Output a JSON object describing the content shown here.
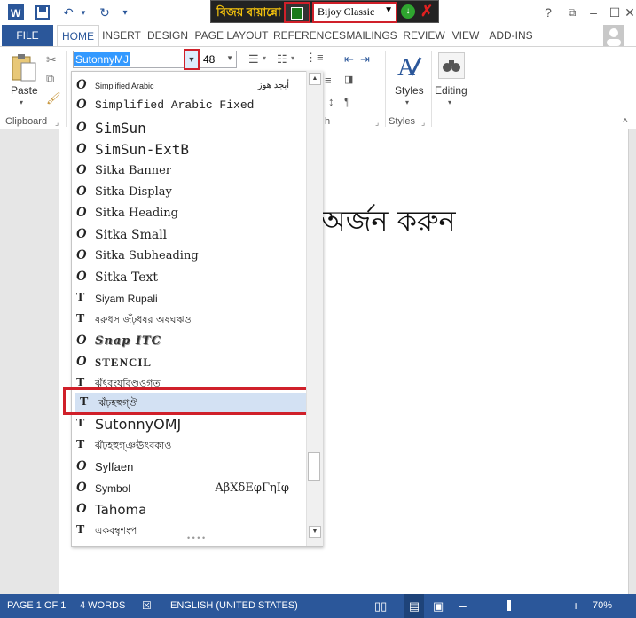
{
  "titlebar": {
    "bijoy_logo_left": "বিজয়",
    "bijoy_logo_right": "বায়ান্নো",
    "keyboard_select": "Bijoy Classic"
  },
  "tabs": [
    "FILE",
    "HOME",
    "INSERT",
    "DESIGN",
    "PAGE LAYOUT",
    "REFERENCES",
    "MAILINGS",
    "REVIEW",
    "VIEW",
    "ADD-INS"
  ],
  "ribbon": {
    "paste_label": "Paste",
    "clipboard_label": "Clipboard",
    "font_name": "SutonnyMJ",
    "font_size": "48",
    "styles_group_label": "Styles",
    "styles_button": "Styles",
    "editing_button": "Editing",
    "paragraph_label_fragment": "h"
  },
  "document": {
    "visible_text": "অর্জন করুন"
  },
  "font_list": [
    {
      "name": "Simplified Arabic",
      "sample": "أبجد هوز",
      "icon": "opentype-icon"
    },
    {
      "name": "Simplified Arabic Fixed",
      "sample": "",
      "icon": "opentype-icon"
    },
    {
      "name": "SimSun",
      "sample": "",
      "icon": "opentype-icon"
    },
    {
      "name": "SimSun-ExtB",
      "sample": "",
      "icon": "opentype-icon"
    },
    {
      "name": "Sitka Banner",
      "sample": "",
      "icon": "opentype-icon"
    },
    {
      "name": "Sitka Display",
      "sample": "",
      "icon": "opentype-icon"
    },
    {
      "name": "Sitka Heading",
      "sample": "",
      "icon": "opentype-icon"
    },
    {
      "name": "Sitka Small",
      "sample": "",
      "icon": "opentype-icon"
    },
    {
      "name": "Sitka Subheading",
      "sample": "",
      "icon": "opentype-icon"
    },
    {
      "name": "Sitka Text",
      "sample": "",
      "icon": "opentype-icon"
    },
    {
      "name": "Siyam Rupali",
      "sample": "",
      "icon": "truetype-icon"
    },
    {
      "name": "ষরুধস জঁঢ়ধষর অষঘঋও",
      "sample": "",
      "icon": "truetype-icon"
    },
    {
      "name": "Snap ITC",
      "sample": "",
      "icon": "opentype-icon"
    },
    {
      "name": "STENCIL",
      "sample": "",
      "icon": "opentype-icon"
    },
    {
      "name": "ঝঁৎবংযবিণ্ডওগ্ত",
      "sample": "",
      "icon": "truetype-icon"
    },
    {
      "name": "ঝঁঢ়হহুগ্ঔ",
      "sample": "",
      "icon": "truetype-icon"
    },
    {
      "name": "SutonnyOMJ",
      "sample": "",
      "icon": "truetype-icon"
    },
    {
      "name": "ঝঁঢ়হহুগ্ঞঊৎবকাও",
      "sample": "",
      "icon": "truetype-icon"
    },
    {
      "name": "Sylfaen",
      "sample": "",
      "icon": "opentype-icon"
    },
    {
      "name": "Symbol",
      "sample": "ΑβΧδΕφΓηΙφ",
      "icon": "opentype-icon"
    },
    {
      "name": "Tahoma",
      "sample": "",
      "icon": "opentype-icon"
    },
    {
      "name": "একবম্বৃশংপ",
      "sample": "",
      "icon": "truetype-icon"
    }
  ],
  "selected_font_index": 15,
  "status": {
    "page": "PAGE 1 OF 1",
    "words": "4 WORDS",
    "language": "ENGLISH (UNITED STATES)",
    "zoom": "70%"
  },
  "colors": {
    "word_blue": "#2b579a",
    "highlight_red": "#d0202a",
    "selection": "#d3e1f3"
  }
}
